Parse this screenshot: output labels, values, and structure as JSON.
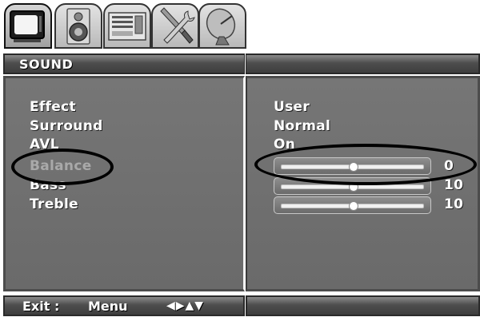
{
  "tabs": [
    {
      "name": "picture",
      "selected": true
    },
    {
      "name": "sound",
      "selected": false
    },
    {
      "name": "setup",
      "selected": false
    },
    {
      "name": "tools",
      "selected": false
    },
    {
      "name": "satellite",
      "selected": false
    }
  ],
  "menu": {
    "title": "SOUND",
    "items": [
      {
        "label": "Effect",
        "value": "User"
      },
      {
        "label": "Surround",
        "value": "Normal"
      },
      {
        "label": "AVL",
        "value": "On"
      },
      {
        "label": "Balance",
        "value": "0",
        "level": 0.5,
        "highlighted": true
      },
      {
        "label": "Bass",
        "value": "10",
        "level": 0.5
      },
      {
        "label": "Treble",
        "value": "10",
        "level": 0.5
      }
    ]
  },
  "footer": {
    "exit_label": "Exit :",
    "menu_label": "Menu",
    "nav_glyphs": "◀▶▲▼"
  },
  "colors": {
    "panel": "#6e6e6e",
    "highlight_text": "#a9a9a9",
    "text": "#ffffff"
  }
}
